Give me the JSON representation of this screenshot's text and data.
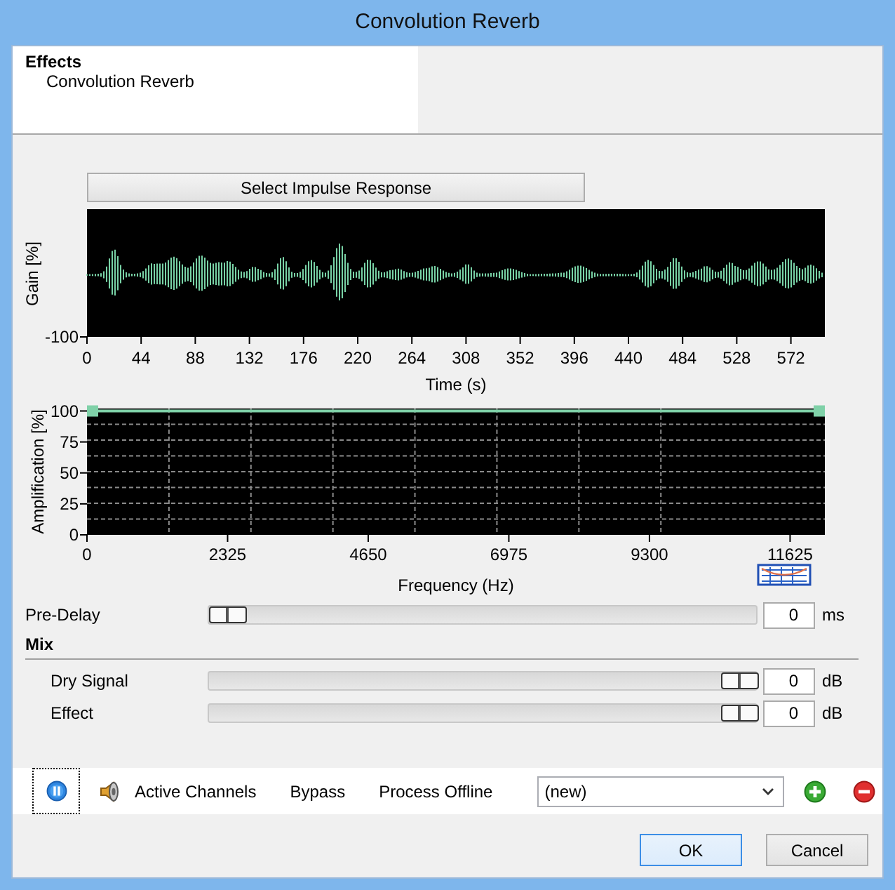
{
  "window": {
    "title": "Convolution Reverb"
  },
  "header": {
    "category": "Effects",
    "item": "Convolution Reverb"
  },
  "select_button": {
    "label": "Select Impulse Response"
  },
  "time_chart": {
    "ylabel": "Gain [%]",
    "yticks": [
      "-100"
    ],
    "xticks": [
      "0",
      "44",
      "88",
      "132",
      "176",
      "220",
      "264",
      "308",
      "352",
      "396",
      "440",
      "484",
      "528",
      "572"
    ],
    "xlabel": "Time (s)"
  },
  "frequency_chart": {
    "chart_data": {
      "type": "line",
      "xlabel": "Frequency (Hz)",
      "ylabel": "Amplification [%]",
      "x": [
        0,
        12200
      ],
      "series": [
        {
          "color": "#7fd1a8",
          "values": [
            100,
            100
          ]
        }
      ],
      "grid": true,
      "xlim": [
        0,
        12200
      ],
      "ylim": [
        0,
        102
      ],
      "xticks": [
        0,
        2325,
        4650,
        6975,
        9300,
        11625
      ],
      "yticks": [
        0,
        25,
        50,
        75,
        100
      ]
    }
  },
  "pre_delay": {
    "label": "Pre-Delay",
    "level": 0,
    "value": "0",
    "unit": "ms"
  },
  "mix": {
    "title": "Mix",
    "rows": [
      {
        "label": "Dry Signal",
        "level": 1,
        "value": "0",
        "unit": "dB"
      },
      {
        "label": "Effect",
        "level": 1,
        "value": "0",
        "unit": "dB"
      }
    ]
  },
  "toolbar": {
    "pause_focused": true,
    "buttons": [
      {
        "kind": "speaker",
        "label": "Active Channels"
      },
      {
        "kind": "text",
        "label": "Bypass"
      },
      {
        "kind": "text",
        "label": "Process Offline"
      }
    ],
    "preset": {
      "value": "(new)"
    }
  },
  "dialog_buttons": [
    {
      "label": "OK",
      "default": true
    },
    {
      "label": "Cancel",
      "default": false
    }
  ]
}
